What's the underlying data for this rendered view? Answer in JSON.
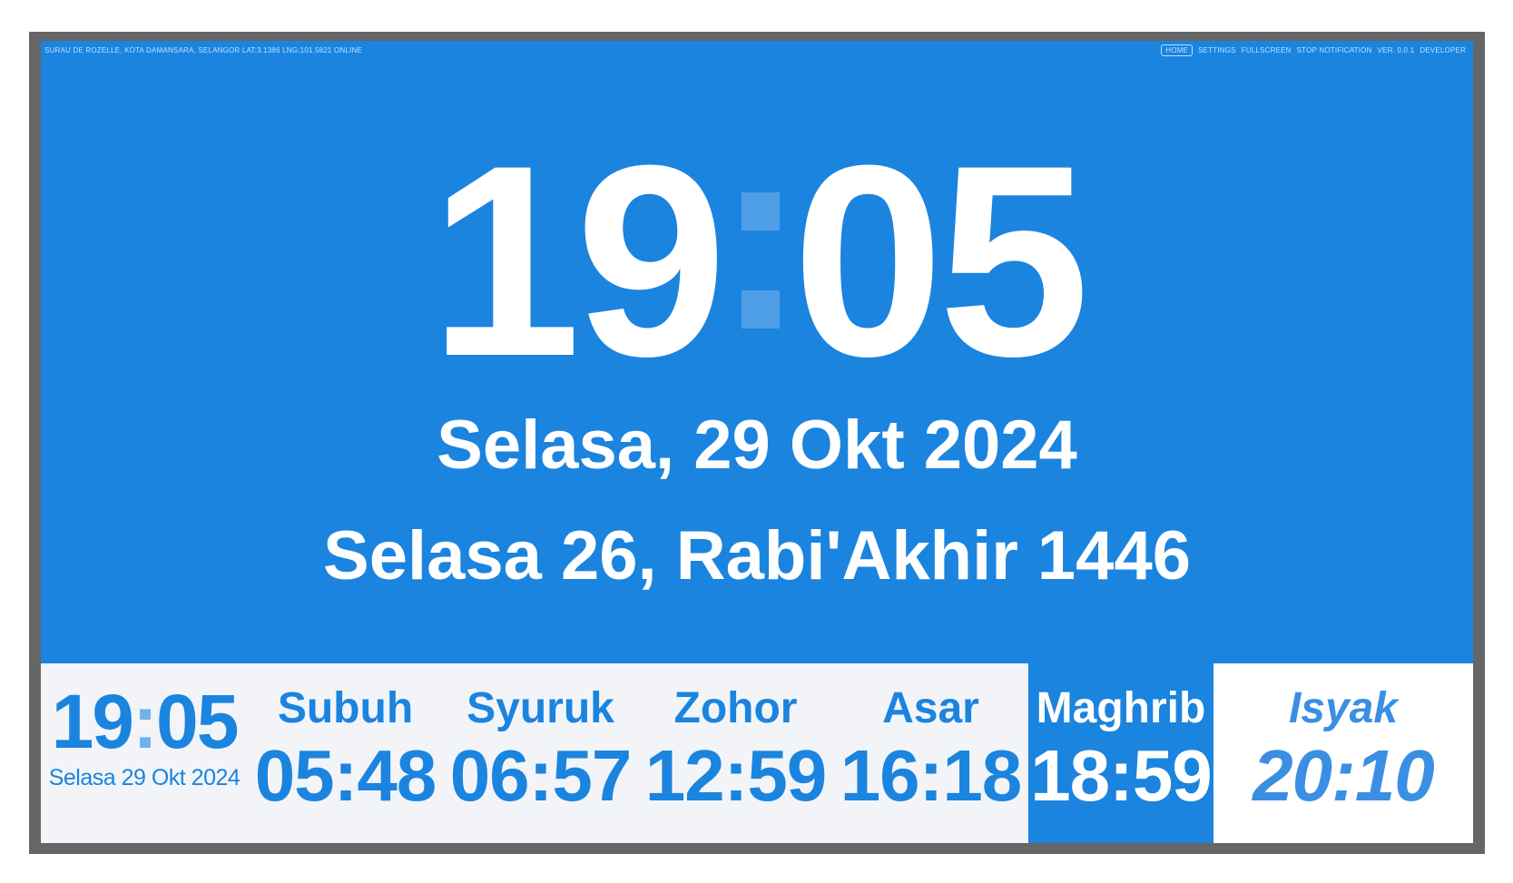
{
  "topbar": {
    "info": "SURAU DE ROZELLE, KOTA DAMANSARA, SELANGOR LAT:3.1386 LNG:101.5821 ONLINE",
    "menu": {
      "home": "HOME",
      "settings": "SETTINGS",
      "fullscreen": "FULLSCREEN",
      "stop_notification": "STOP NOTIFICATION",
      "version": "VER. 0.0.1",
      "developer": "DEVELOPER"
    }
  },
  "clock": {
    "hours": "19",
    "minutes": "05"
  },
  "dates": {
    "gregorian": "Selasa, 29 Okt 2024",
    "hijri": "Selasa 26, Rabi'Akhir 1446"
  },
  "mini_clock": {
    "hours": "19",
    "separator": ":",
    "minutes": "05",
    "date": "Selasa 29 Okt 2024"
  },
  "prayers": [
    {
      "name": "Subuh",
      "time": "05:48"
    },
    {
      "name": "Syuruk",
      "time": "06:57"
    },
    {
      "name": "Zohor",
      "time": "12:59"
    },
    {
      "name": "Asar",
      "time": "16:18"
    },
    {
      "name": "Maghrib",
      "time": "18:59"
    },
    {
      "name": "Isyak",
      "time": "20:10"
    }
  ],
  "colors": {
    "background": "#1b84df",
    "bottom_panel": "#f2f4f8",
    "accent": "#1b84df",
    "frame": "#666666",
    "text_on_blue": "#ffffff"
  }
}
